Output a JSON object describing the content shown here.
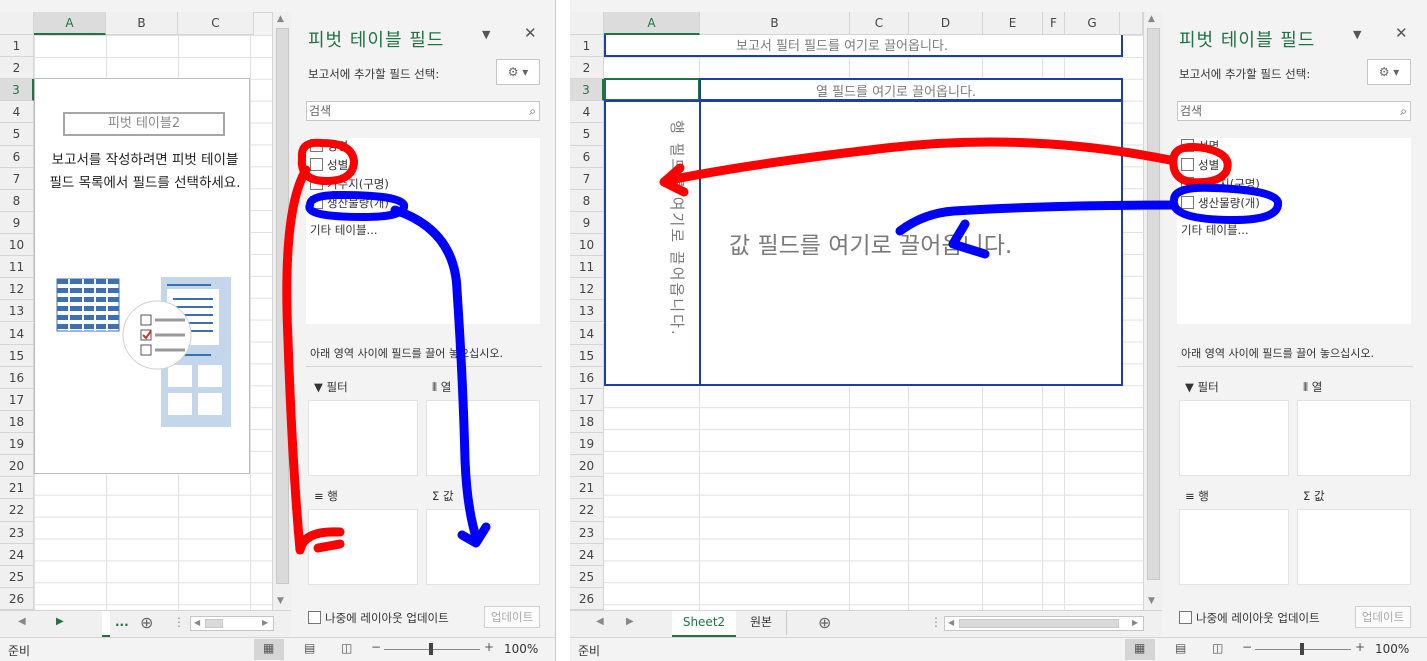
{
  "left": {
    "columns": [
      "A",
      "B",
      "C"
    ],
    "rows": [
      "1",
      "2",
      "3",
      "4",
      "5",
      "6",
      "7",
      "8",
      "9",
      "10",
      "11",
      "12",
      "13",
      "14",
      "15",
      "16",
      "17",
      "18",
      "19",
      "20",
      "21",
      "22",
      "23",
      "24",
      "25",
      "26"
    ],
    "pivot_placeholder": {
      "name": "피벗 테이블2",
      "instruction": "보고서를 작성하려면 피벗 테이블 필드 목록에서 필드를 선택하세요."
    },
    "tab_ellipsis": "...",
    "add_sheet": "⊕"
  },
  "right": {
    "columns": [
      "A",
      "B",
      "C",
      "D",
      "E",
      "F",
      "G"
    ],
    "rows": [
      "1",
      "2",
      "3",
      "4",
      "5",
      "6",
      "7",
      "8",
      "9",
      "10",
      "11",
      "12",
      "13",
      "14",
      "15",
      "16",
      "17",
      "18",
      "19",
      "20",
      "21",
      "22",
      "23",
      "24",
      "25",
      "26"
    ],
    "drop_hints": {
      "filter": "보고서 필터 필드를 여기로 끌어옵니다.",
      "column": "열 필드를 여기로 끌어옵니다.",
      "row": "행 필드를 여기로 끌어옵니다.",
      "value": "값 필드를 여기로 끌어옵니다."
    },
    "tabs": [
      "Sheet2",
      "원본"
    ],
    "add_sheet": "⊕"
  },
  "field_panel": {
    "title": "피벗 테이블 필드",
    "subtitle": "보고서에 추가할 필드 선택:",
    "search_placeholder": "검색",
    "fields": [
      "성명",
      "성별",
      "거주지(구명)",
      "생산물량(개)"
    ],
    "more_tables": "기타 테이블...",
    "areas_hint": "아래 영역 사이에 필드를 끌어 놓으십시오.",
    "area_filter": "필터",
    "area_column": "열",
    "area_row": "행",
    "area_value": "값",
    "defer_label": "나중에 레이아웃 업데이트",
    "update_button": "업데이트"
  },
  "status": {
    "ready": "준비",
    "zoom": "100%"
  },
  "colors": {
    "excel_green": "#217346",
    "pivot_blue": "#1f3fa8",
    "annot_red": "#ff0000",
    "annot_blue": "#0000ff"
  }
}
